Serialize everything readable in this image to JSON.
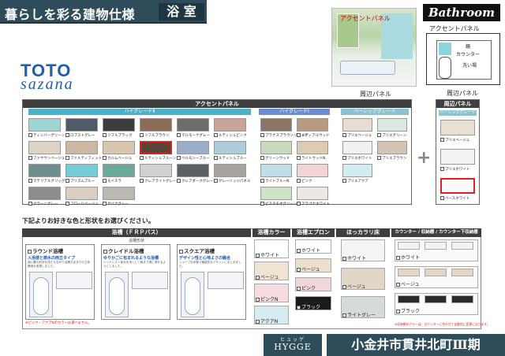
{
  "header": {
    "title": "暮らしを彩る建物仕様",
    "room": "浴 室",
    "badge": "Bathroom"
  },
  "brand": {
    "maker": "TOTO",
    "series": "sazana"
  },
  "photo_labels": {
    "accent_panel": "アクセントパネル",
    "surround_panel": "周辺パネル"
  },
  "diagram": {
    "label": "アクセントパネル",
    "parts": [
      "鏡",
      "カウンター",
      "洗い場"
    ],
    "caption": "周辺パネル"
  },
  "accent_panel": {
    "header": "アクセントパネル",
    "groups": [
      {
        "name": "ハイグレードⅡ",
        "color": "#4ab1c9",
        "items": [
          {
            "label": "ティンバーグリーン",
            "color": "#9fd6d3"
          },
          {
            "label": "ロブストグレー",
            "color": "#4f5b66"
          },
          {
            "label": "リフルブラック",
            "color": "#3d3d3f"
          },
          {
            "label": "リフルブラウン",
            "color": "#8b6d57"
          },
          {
            "label": "マルモーナグレー",
            "color": "#6f6d6b"
          },
          {
            "label": "ルティシュピンク",
            "color": "#c9a39a"
          },
          {
            "label": "ファヤウンベージュ",
            "color": "#ddd2c3"
          },
          {
            "label": "ファルティフィット",
            "color": "#c9b8a3"
          },
          {
            "label": "カルムベージュ",
            "color": "#d8c6b0"
          },
          {
            "label": "ルティシュブルーン",
            "color": "#5a4437"
          },
          {
            "label": "ベルモシーブルー",
            "color": "#9aaecb"
          },
          {
            "label": "ルティシュブルー",
            "color": "#aecbd8"
          },
          {
            "label": "マテリアルグリッグ",
            "color": "#6e8d8e"
          },
          {
            "label": "プリズムブルー",
            "color": "#72cdd9"
          },
          {
            "label": "モイスラ",
            "color": "#6aaa9b"
          },
          {
            "label": "クレアライトグレー",
            "color": "#cfd2d0"
          },
          {
            "label": "クレアダークグレー",
            "color": "#5c6062"
          },
          {
            "label": "グレーリッジパネル",
            "color": "#a8a39e"
          },
          {
            "label": "グラーニグレー",
            "color": "#8d8d8b"
          },
          {
            "label": "フロールベージュ",
            "color": "#d8cfc2"
          },
          {
            "label": "サバナグレー",
            "color": "#bcb9b5"
          }
        ],
        "selected_index": 9
      },
      {
        "name": "ハイグレードⅠ",
        "color": "#6b8ed0",
        "items": [
          {
            "label": "プラナスブラウンリキッド",
            "color": "#8b7366"
          },
          {
            "label": "エディアルウッド",
            "color": "#b89a7c"
          },
          {
            "label": "グリーンウッド",
            "color": "#c8d9c0"
          },
          {
            "label": "ライトウッドN",
            "color": "#dcccb6"
          },
          {
            "label": "ライトブルーN",
            "color": "#bfdfe8"
          },
          {
            "label": "ピンク",
            "color": "#f2d3d6"
          },
          {
            "label": "ピスタチオグリーン",
            "color": "#cfe3c7"
          },
          {
            "label": "アラゴナホワイト",
            "color": "#ece8e3"
          }
        ]
      },
      {
        "name": "ベーシックグレード",
        "color": "#8bc1d1",
        "items": [
          {
            "label": "プリエベージュ",
            "color": "#e7ddd0"
          },
          {
            "label": "プリエグリーン",
            "color": "#d9e9df"
          },
          {
            "label": "プリエホワイト",
            "color": "#f1f1ef"
          },
          {
            "label": "プリエブラウン",
            "color": "#d3c5b5"
          },
          {
            "label": "プリエアクア",
            "color": "#d1ecf1"
          }
        ]
      }
    ]
  },
  "surround_panel": {
    "header": "周辺パネル",
    "group": "ベーシックグレード",
    "items": [
      {
        "label": "プリエベージュ",
        "color": "#e9e0d4"
      },
      {
        "label": "プリエホワイト",
        "color": "#f3f3f1"
      },
      {
        "label": "ベースホワイト",
        "color": "#fafafa"
      }
    ],
    "selected_index": 2
  },
  "instruction": "下記よりお好きな色と形状をお選びください。",
  "bathtub": {
    "header": "浴槽（ＦＲＰバス）",
    "subheader": "浴槽形状",
    "types": [
      {
        "name": "ラウンド浴槽",
        "tagline": "入浴感と節水の両立タイプ",
        "desc": "適い腰の形状を持たせながら浴槽すぼまりの立体構造を実現しました。"
      },
      {
        "name": "クレイドル浴槽",
        "tagline": "ゆりかごに包まれるような浴槽",
        "desc": "ヘッドレスト部分を深くして肩まで湯に浸れるようにしました。"
      },
      {
        "name": "スクエア浴槽",
        "tagline": "デザイン性と心地よさの融合",
        "desc": "シャープな印象で機能的なデザインにまとめました。"
      }
    ],
    "selected_index": 2,
    "note": "※ピンク・アクアNのカラーは選べません。"
  },
  "tub_color": {
    "header": "浴槽カラー",
    "options": [
      "ホワイト",
      "ベージュ",
      "ピンクN",
      "アクアN"
    ],
    "swatches": [
      "#ffffff",
      "#efe4d2",
      "#f6dbe0",
      "#d5ecf1"
    ],
    "selected_index": 0
  },
  "apron": {
    "header": "浴槽エプロン",
    "options": [
      "ホワイト",
      "ベージュ",
      "ピンク",
      "ブラック"
    ],
    "swatches": [
      "#ffffff",
      "#ecdfcb",
      "#f2d7da",
      "#1a1a1a"
    ],
    "selected_index": 3
  },
  "floor": {
    "header": "ほっカラリ床",
    "options": [
      "ホワイト",
      "ベージュ",
      "ライトグレー"
    ],
    "swatches": [
      "#f4f4f2",
      "#e2d6c6",
      "#d7dadb"
    ],
    "selected_index": 2
  },
  "counter": {
    "header": "カウンター / 収納棚 / カウンター下収納棚",
    "options": [
      "ホワイト",
      "ベージュ",
      "ブラック"
    ],
    "selected_index": 2,
    "note": "※収納棚のカラーは、カウンターに合わせて自動的に変更になります。"
  },
  "footer": {
    "ruby": "ヒュッゲ",
    "brand": "HYGGE",
    "location": "小金井市貫井北町Ⅲ期"
  }
}
